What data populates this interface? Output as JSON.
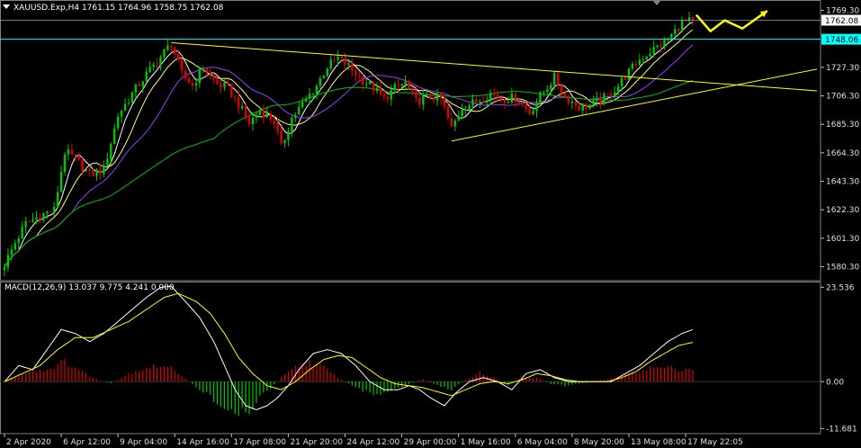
{
  "window": {
    "title": "XAUUSD.Exp,H4  1761.15 1764.96 1758.75 1762.08"
  },
  "colors": {
    "background": "#000000",
    "bull": "#00c800",
    "bear": "#e00000",
    "ma_fast": "#ffffff",
    "ma_mid": "#ffff80",
    "ma_slow": "#9a3cff",
    "ma_long": "#00c000",
    "trendline": "#ffff00",
    "price_line": "#00ffff",
    "arrow": "#ffff00",
    "macd_line": "#ffffff",
    "signal_line": "#ffff00"
  },
  "chart_data": [
    {
      "type": "candlestick",
      "title": "XAUUSD.Exp,H4  1761.15 1764.96 1758.75 1762.08",
      "ylim": [
        1572,
        1775
      ],
      "y_ticks": [
        1769.3,
        1748.06,
        1727.3,
        1706.3,
        1685.3,
        1664.3,
        1643.3,
        1622.3,
        1601.3,
        1580.3
      ],
      "y_tick_labels": [
        "1769.30",
        "1762.08",
        "1748.06",
        "1727.30",
        "1706.30",
        "1685.30",
        "1664.30",
        "1643.30",
        "1622.30",
        "1601.30",
        "1580.30"
      ],
      "current_price": 1762.08,
      "marked_level": 1748.06,
      "x_labels": [
        "2 Apr 2020",
        "6 Apr 12:00",
        "9 Apr 04:00",
        "14 Apr 16:00",
        "17 Apr 08:00",
        "21 Apr 20:00",
        "24 Apr 12:00",
        "29 Apr 00:00",
        "1 May 16:00",
        "6 May 04:00",
        "8 May 20:00",
        "13 May 08:00",
        "17 May 22:05"
      ],
      "x_label_index": [
        0,
        16,
        32,
        48,
        64,
        80,
        96,
        112,
        128,
        144,
        160,
        176,
        192
      ],
      "close_path": [
        [
          0,
          1582
        ],
        [
          3,
          1598
        ],
        [
          6,
          1612
        ],
        [
          10,
          1618
        ],
        [
          14,
          1622
        ],
        [
          17,
          1665
        ],
        [
          20,
          1660
        ],
        [
          24,
          1648
        ],
        [
          28,
          1652
        ],
        [
          32,
          1692
        ],
        [
          36,
          1708
        ],
        [
          40,
          1722
        ],
        [
          44,
          1735
        ],
        [
          47,
          1745
        ],
        [
          50,
          1722
        ],
        [
          53,
          1714
        ],
        [
          56,
          1728
        ],
        [
          60,
          1715
        ],
        [
          63,
          1712
        ],
        [
          66,
          1700
        ],
        [
          69,
          1686
        ],
        [
          72,
          1696
        ],
        [
          76,
          1688
        ],
        [
          78,
          1668
        ],
        [
          81,
          1690
        ],
        [
          84,
          1700
        ],
        [
          88,
          1714
        ],
        [
          91,
          1728
        ],
        [
          94,
          1734
        ],
        [
          97,
          1728
        ],
        [
          100,
          1720
        ],
        [
          104,
          1712
        ],
        [
          107,
          1704
        ],
        [
          110,
          1712
        ],
        [
          113,
          1716
        ],
        [
          116,
          1702
        ],
        [
          120,
          1706
        ],
        [
          123,
          1704
        ],
        [
          126,
          1682
        ],
        [
          129,
          1698
        ],
        [
          133,
          1702
        ],
        [
          137,
          1708
        ],
        [
          141,
          1704
        ],
        [
          144,
          1705
        ],
        [
          148,
          1694
        ],
        [
          151,
          1706
        ],
        [
          155,
          1720
        ],
        [
          158,
          1706
        ],
        [
          162,
          1698
        ],
        [
          166,
          1700
        ],
        [
          170,
          1706
        ],
        [
          173,
          1714
        ],
        [
          176,
          1724
        ],
        [
          179,
          1733
        ],
        [
          182,
          1739
        ],
        [
          185,
          1744
        ],
        [
          188,
          1751
        ],
        [
          191,
          1760
        ],
        [
          194,
          1762
        ]
      ],
      "trendlines": [
        {
          "from": [
            47,
            1745.5
          ],
          "to": [
            229,
            1710
          ]
        },
        {
          "from": [
            126,
            1673
          ],
          "to": [
            229,
            1726
          ]
        }
      ],
      "projection_arrow": [
        [
          195,
          1766
        ],
        [
          199,
          1754
        ],
        [
          203,
          1762
        ],
        [
          208,
          1756
        ],
        [
          215,
          1769
        ]
      ]
    },
    {
      "type": "bar",
      "title": "MACD(12,26,9) 13.037 9.775 4.241 0.000",
      "ylim": [
        -12.5,
        24.5
      ],
      "y_ticks": [
        23.536,
        0.0,
        -11.681
      ],
      "y_tick_labels": [
        "23.536",
        "0.00",
        "-11.681"
      ],
      "macd_path": [
        [
          0,
          0
        ],
        [
          4,
          4
        ],
        [
          8,
          3
        ],
        [
          12,
          8
        ],
        [
          16,
          13
        ],
        [
          20,
          12
        ],
        [
          24,
          10
        ],
        [
          28,
          12
        ],
        [
          32,
          15
        ],
        [
          36,
          18
        ],
        [
          40,
          21
        ],
        [
          44,
          23.5
        ],
        [
          47,
          23.8
        ],
        [
          51,
          20
        ],
        [
          55,
          16
        ],
        [
          59,
          10
        ],
        [
          62,
          4
        ],
        [
          65,
          -2
        ],
        [
          68,
          -6
        ],
        [
          71,
          -7
        ],
        [
          74,
          -6
        ],
        [
          77,
          -4
        ],
        [
          80,
          -1
        ],
        [
          83,
          3
        ],
        [
          87,
          7
        ],
        [
          91,
          8
        ],
        [
          95,
          7
        ],
        [
          99,
          4
        ],
        [
          103,
          0
        ],
        [
          107,
          -2
        ],
        [
          111,
          -2
        ],
        [
          114,
          -1
        ],
        [
          117,
          -2
        ],
        [
          120,
          -4
        ],
        [
          124,
          -6
        ],
        [
          127,
          -3
        ],
        [
          131,
          0
        ],
        [
          135,
          1
        ],
        [
          139,
          0
        ],
        [
          143,
          -2
        ],
        [
          147,
          2
        ],
        [
          151,
          3
        ],
        [
          155,
          1
        ],
        [
          159,
          0
        ],
        [
          163,
          0
        ],
        [
          167,
          0
        ],
        [
          171,
          0
        ],
        [
          175,
          2
        ],
        [
          179,
          4
        ],
        [
          183,
          7
        ],
        [
          187,
          10
        ],
        [
          191,
          12
        ],
        [
          194,
          13.0
        ]
      ],
      "signal_path": [
        [
          0,
          0
        ],
        [
          5,
          2
        ],
        [
          10,
          4
        ],
        [
          15,
          8
        ],
        [
          20,
          11
        ],
        [
          25,
          11
        ],
        [
          30,
          13
        ],
        [
          35,
          15
        ],
        [
          40,
          18
        ],
        [
          45,
          21
        ],
        [
          49,
          22
        ],
        [
          54,
          20
        ],
        [
          58,
          17
        ],
        [
          62,
          12
        ],
        [
          66,
          6
        ],
        [
          70,
          2
        ],
        [
          74,
          -1
        ],
        [
          78,
          -2
        ],
        [
          82,
          0
        ],
        [
          86,
          3
        ],
        [
          90,
          5.5
        ],
        [
          94,
          6.5
        ],
        [
          98,
          6
        ],
        [
          102,
          3.5
        ],
        [
          106,
          1
        ],
        [
          110,
          -0.5
        ],
        [
          114,
          -1
        ],
        [
          118,
          -1.5
        ],
        [
          122,
          -2.5
        ],
        [
          126,
          -3.5
        ],
        [
          130,
          -2
        ],
        [
          134,
          -0.5
        ],
        [
          138,
          0
        ],
        [
          142,
          -0.5
        ],
        [
          146,
          0.5
        ],
        [
          150,
          2
        ],
        [
          154,
          1.5
        ],
        [
          158,
          0.5
        ],
        [
          162,
          0
        ],
        [
          166,
          0
        ],
        [
          170,
          0
        ],
        [
          174,
          1
        ],
        [
          178,
          2.5
        ],
        [
          182,
          5
        ],
        [
          186,
          7
        ],
        [
          190,
          9
        ],
        [
          194,
          9.8
        ]
      ],
      "histogram_envelope": [
        [
          0,
          0
        ],
        [
          6,
          2.5
        ],
        [
          12,
          3
        ],
        [
          17,
          5
        ],
        [
          21,
          3
        ],
        [
          26,
          0.5
        ],
        [
          30,
          -0.5
        ],
        [
          35,
          2
        ],
        [
          40,
          3.5
        ],
        [
          44,
          4
        ],
        [
          48,
          3
        ],
        [
          52,
          0
        ],
        [
          56,
          -2.5
        ],
        [
          60,
          -5
        ],
        [
          63,
          -7
        ],
        [
          66,
          -8
        ],
        [
          69,
          -7
        ],
        [
          72,
          -4
        ],
        [
          75,
          -1.5
        ],
        [
          78,
          1
        ],
        [
          82,
          3.5
        ],
        [
          86,
          5
        ],
        [
          90,
          3.5
        ],
        [
          94,
          1
        ],
        [
          98,
          -1
        ],
        [
          102,
          -2.5
        ],
        [
          106,
          -3.5
        ],
        [
          110,
          -2
        ],
        [
          114,
          -0.5
        ],
        [
          118,
          0.5
        ],
        [
          122,
          -1
        ],
        [
          126,
          -2
        ],
        [
          130,
          0.5
        ],
        [
          134,
          2.2
        ],
        [
          138,
          1
        ],
        [
          142,
          -1
        ],
        [
          146,
          1.2
        ],
        [
          150,
          1
        ],
        [
          154,
          -0.5
        ],
        [
          158,
          -1
        ],
        [
          162,
          -0.5
        ],
        [
          166,
          0
        ],
        [
          170,
          0.5
        ],
        [
          174,
          1.5
        ],
        [
          178,
          2.5
        ],
        [
          182,
          3.5
        ],
        [
          186,
          3.5
        ],
        [
          190,
          3.2
        ],
        [
          194,
          3.2
        ]
      ]
    }
  ]
}
